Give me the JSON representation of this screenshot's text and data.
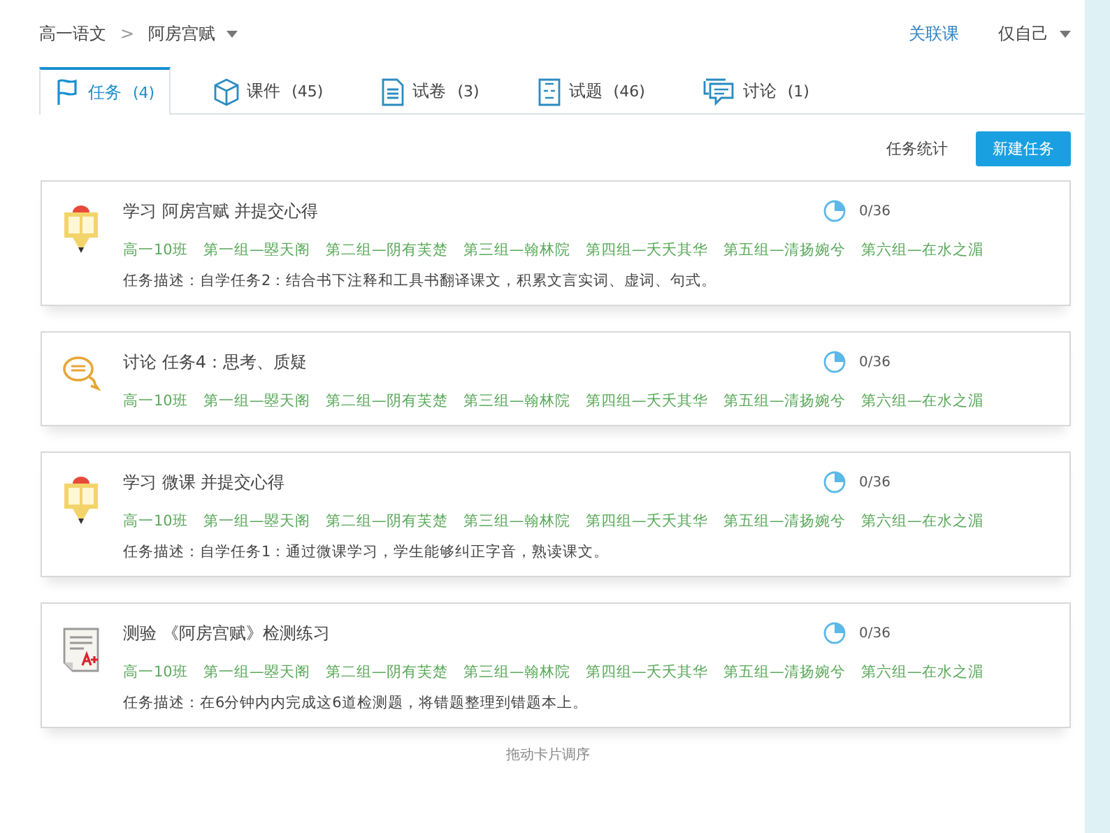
{
  "breadcrumb": {
    "course": "高一语文",
    "separator": ">",
    "lesson": "阿房宫赋"
  },
  "header_links": {
    "linked_course": "关联课",
    "scope": "仅自己"
  },
  "tabs": [
    {
      "label": "任务",
      "count": "(4)",
      "kind": "flag",
      "selected": true
    },
    {
      "label": "课件",
      "count": "(45)",
      "kind": "cube",
      "selected": false
    },
    {
      "label": "试卷",
      "count": "(3)",
      "kind": "doc",
      "selected": false
    },
    {
      "label": "试题",
      "count": "(46)",
      "kind": "abc",
      "selected": false
    },
    {
      "label": "讨论",
      "count": "(1)",
      "kind": "chat",
      "selected": false
    }
  ],
  "toolbar": {
    "stats": "任务统计",
    "new_task": "新建任务"
  },
  "tasks": [
    {
      "kind": "study",
      "title": "学习 阿房宫赋 并提交心得",
      "progress": "0/36",
      "groups": [
        "高一10班",
        "第一组—曌天阁",
        "第二组—阴有芙楚",
        "第三组—翰林院",
        "第四组—夭夭其华",
        "第五组—清扬婉兮",
        "第六组—在水之湄"
      ],
      "description": "任务描述：自学任务2：结合书下注释和工具书翻译课文，积累文言实词、虚词、句式。"
    },
    {
      "kind": "discuss",
      "title": "讨论 任务4：思考、质疑",
      "progress": "0/36",
      "groups": [
        "高一10班",
        "第一组—曌天阁",
        "第二组—阴有芙楚",
        "第三组—翰林院",
        "第四组—夭夭其华",
        "第五组—清扬婉兮",
        "第六组—在水之湄"
      ]
    },
    {
      "kind": "study",
      "title": "学习 微课 并提交心得",
      "progress": "0/36",
      "groups": [
        "高一10班",
        "第一组—曌天阁",
        "第二组—阴有芙楚",
        "第三组—翰林院",
        "第四组—夭夭其华",
        "第五组—清扬婉兮",
        "第六组—在水之湄"
      ],
      "description": "任务描述：自学任务1：通过微课学习，学生能够纠正字音，熟读课文。"
    },
    {
      "kind": "quiz",
      "title": "测验 《阿房宫赋》检测练习",
      "progress": "0/36",
      "groups": [
        "高一10班",
        "第一组—曌天阁",
        "第二组—阴有芙楚",
        "第三组—翰林院",
        "第四组—夭夭其华",
        "第五组—清扬婉兮",
        "第六组—在水之湄"
      ],
      "description": "任务描述：在6分钟内内完成这6道检测题，将错题整理到错题本上。"
    }
  ],
  "footer_hint": "拖动卡片调序"
}
